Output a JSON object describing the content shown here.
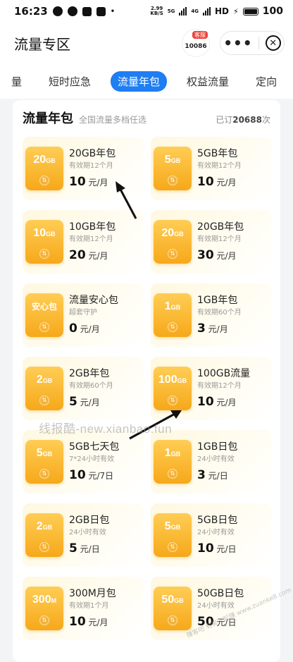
{
  "status_bar": {
    "time": "16:23",
    "net_speed_top": "2.99",
    "net_speed_bottom": "KB/S",
    "signal_label_1": "5G",
    "signal_label_2": "4G",
    "hd_label": "HD",
    "battery": "100"
  },
  "header": {
    "title": "流量专区",
    "logo_tag": "客服",
    "logo_number": "10086",
    "more_icon": "more-dots-icon",
    "close_icon": "close-circle-icon"
  },
  "tabs": [
    {
      "label": "量",
      "active": false
    },
    {
      "label": "短时应急",
      "active": false
    },
    {
      "label": "流量年包",
      "active": true
    },
    {
      "label": "权益流量",
      "active": false
    },
    {
      "label": "定向",
      "active": false
    }
  ],
  "accent_color": "#1e7ef2",
  "panel": {
    "title": "流量年包",
    "subtitle": "全国流量多档任选",
    "count_prefix": "已订",
    "count_value": "20688",
    "count_suffix": "次"
  },
  "packages": [
    {
      "badge": "20",
      "badge_unit": "GB",
      "name": "20GB年包",
      "desc": "有效期12个月",
      "price": "10",
      "unit": "元/月"
    },
    {
      "badge": "5",
      "badge_unit": "GB",
      "name": "5GB年包",
      "desc": "有效期12个月",
      "price": "10",
      "unit": "元/月"
    },
    {
      "badge": "10",
      "badge_unit": "GB",
      "name": "10GB年包",
      "desc": "有效期12个月",
      "price": "20",
      "unit": "元/月"
    },
    {
      "badge": "20",
      "badge_unit": "GB",
      "name": "20GB年包",
      "desc": "有效期12个月",
      "price": "30",
      "unit": "元/月"
    },
    {
      "badge": "安心包",
      "badge_unit": "",
      "name": "流量安心包",
      "desc": "超套守护",
      "price": "0",
      "unit": "元/月"
    },
    {
      "badge": "1",
      "badge_unit": "GB",
      "name": "1GB年包",
      "desc": "有效期60个月",
      "price": "3",
      "unit": "元/月"
    },
    {
      "badge": "2",
      "badge_unit": "GB",
      "name": "2GB年包",
      "desc": "有效期60个月",
      "price": "5",
      "unit": "元/月"
    },
    {
      "badge": "100",
      "badge_unit": "GB",
      "name": "100GB流量",
      "desc": "有效期12个月",
      "price": "10",
      "unit": "元/月"
    },
    {
      "badge": "5",
      "badge_unit": "GB",
      "name": "5GB七天包",
      "desc": "7*24小时有效",
      "price": "10",
      "unit": "元/7日"
    },
    {
      "badge": "1",
      "badge_unit": "GB",
      "name": "1GB日包",
      "desc": "24小时有效",
      "price": "3",
      "unit": "元/日"
    },
    {
      "badge": "2",
      "badge_unit": "GB",
      "name": "2GB日包",
      "desc": "24小时有效",
      "price": "5",
      "unit": "元/日"
    },
    {
      "badge": "5",
      "badge_unit": "GB",
      "name": "5GB日包",
      "desc": "24小时有效",
      "price": "10",
      "unit": "元/日"
    },
    {
      "badge": "300",
      "badge_unit": "M",
      "name": "300M月包",
      "desc": "有效期1个月",
      "price": "10",
      "unit": "元/月"
    },
    {
      "badge": "50",
      "badge_unit": "GB",
      "name": "50GB日包",
      "desc": "24小时有效",
      "price": "50",
      "unit": "元/日"
    }
  ],
  "watermark": "线报酷-new.xianbao.fun",
  "watermark2": "赚客吧 有奖一起赚 www.zuanke8.com"
}
